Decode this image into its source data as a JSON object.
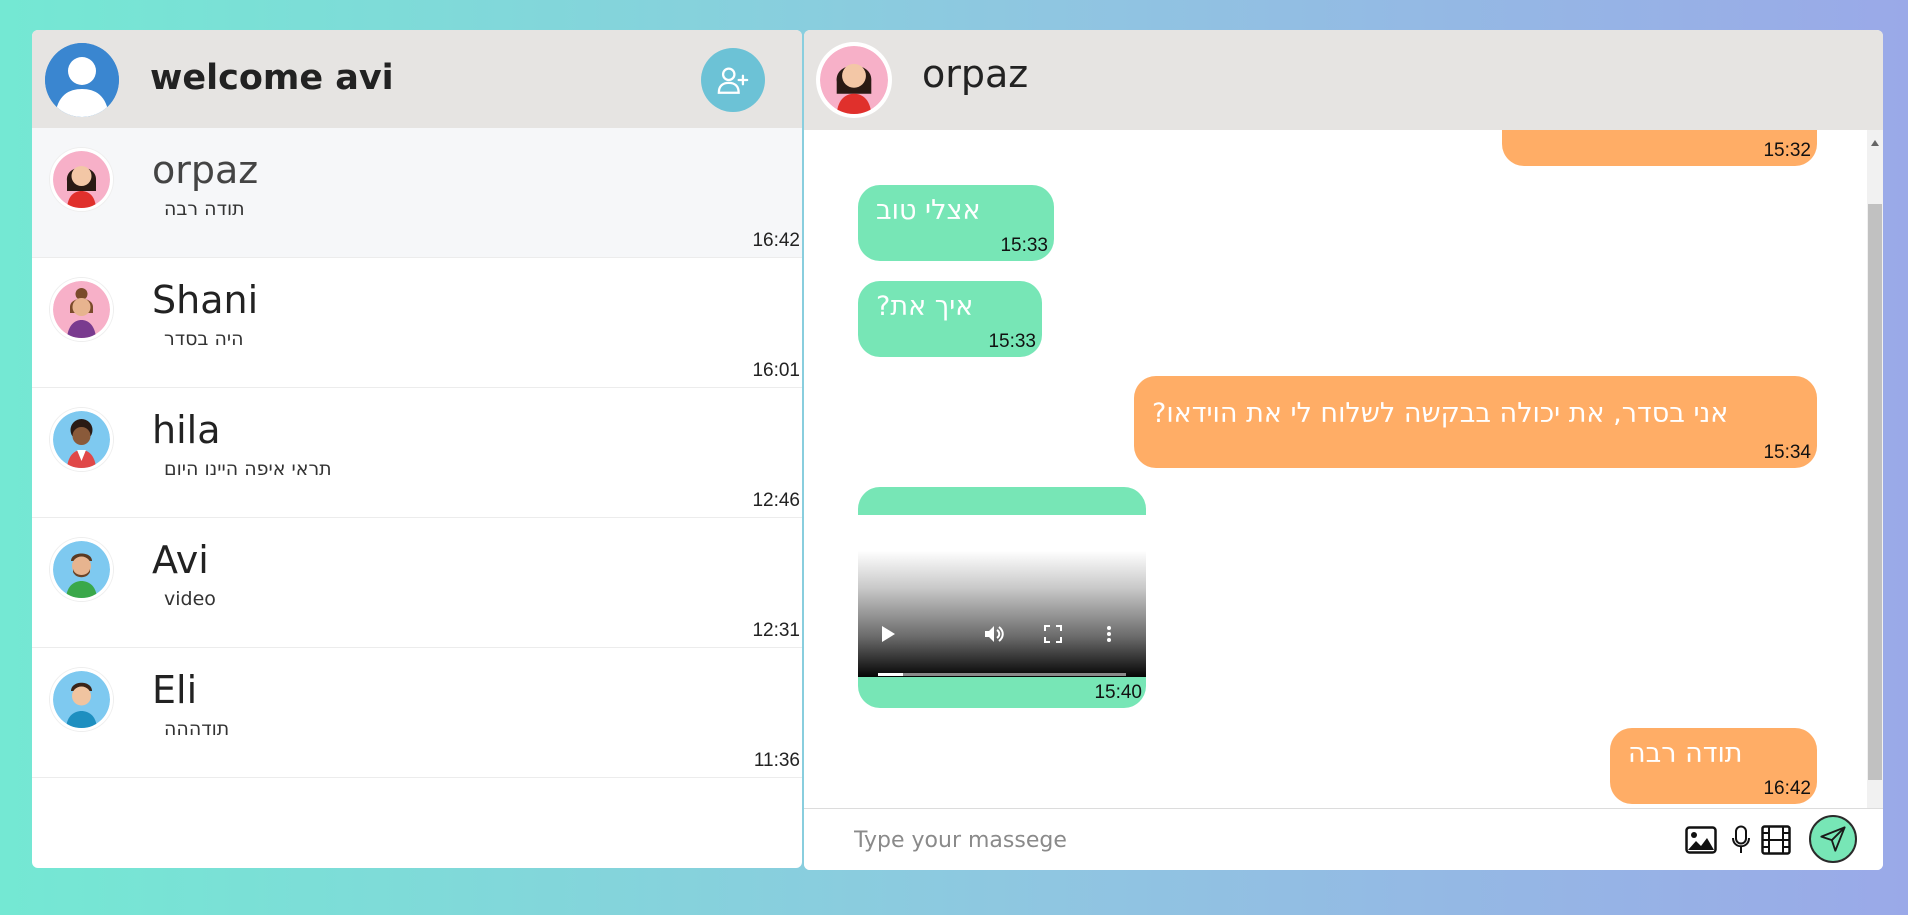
{
  "sidebar": {
    "welcome": "welcome avi",
    "contacts": [
      {
        "name": "orpaz",
        "last": "תודה רבה",
        "time": "16:42"
      },
      {
        "name": "Shani",
        "last": "היה בסדר",
        "time": "16:01"
      },
      {
        "name": "hila",
        "last": "תראי איפה היינו היום",
        "time": "12:46"
      },
      {
        "name": "Avi",
        "last": "video",
        "time": "12:31"
      },
      {
        "name": "Eli",
        "last": "תודההה",
        "time": "11:36"
      }
    ]
  },
  "chat": {
    "contact_name": "orpaz",
    "messages": [
      {
        "dir": "out",
        "text": "",
        "time": "15:32"
      },
      {
        "dir": "in",
        "text": "אצלי טוב",
        "time": "15:33"
      },
      {
        "dir": "in",
        "text": "איך את?",
        "time": "15:33"
      },
      {
        "dir": "out",
        "text": "אני בסדר, את יכולה בבקשה לשלוח לי את הוידאו?",
        "time": "15:34"
      },
      {
        "dir": "in",
        "type": "video",
        "time": "15:40",
        "progress": 0.1
      },
      {
        "dir": "out",
        "text": "תודה רבה",
        "time": "16:42"
      }
    ],
    "input_placeholder": "Type your massege"
  },
  "colors": {
    "incoming": "#77e6b6",
    "outgoing": "#ffad66",
    "header": "#e6e4e2",
    "add_button": "#6cc2d6"
  }
}
